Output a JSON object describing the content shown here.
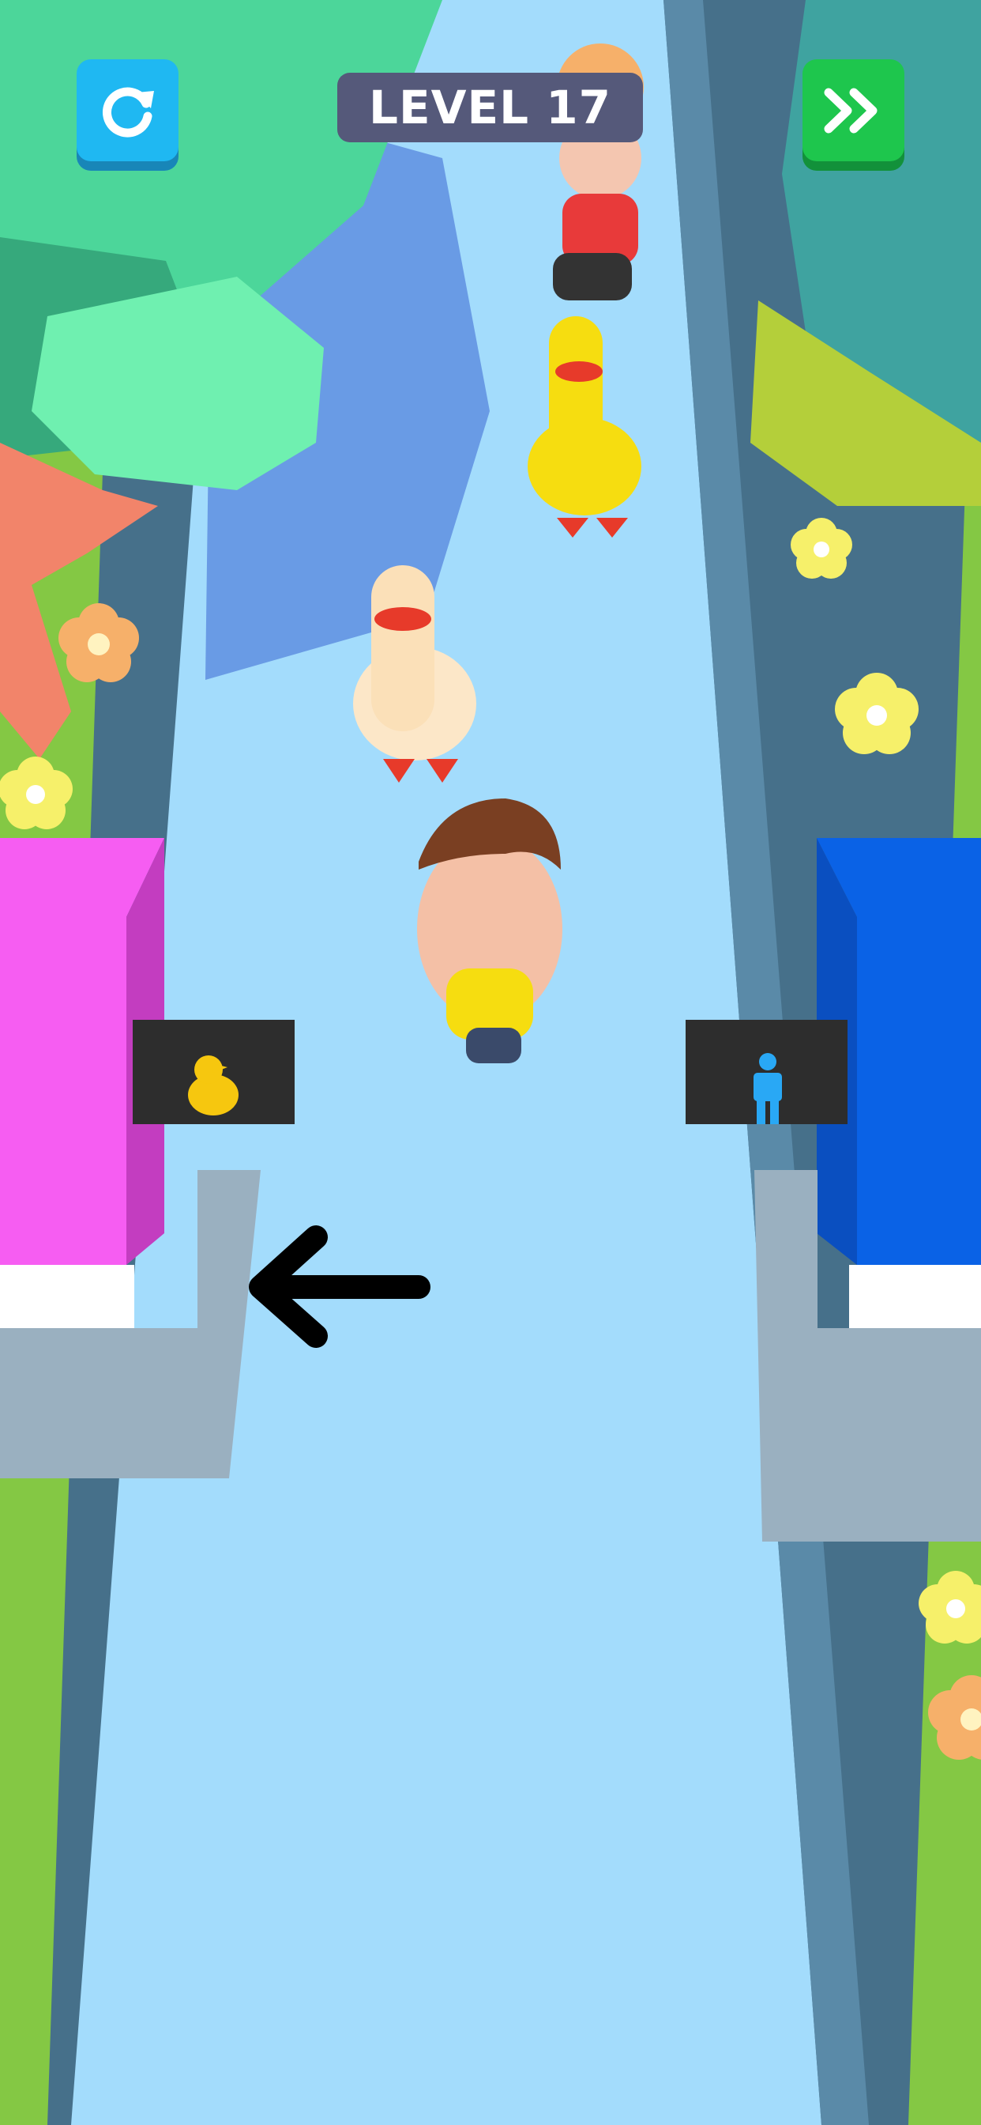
{
  "hud": {
    "level_text": "LEVEL 17",
    "restart_icon": "restart-icon",
    "skip_icon": "fast-forward-icon"
  },
  "gates": {
    "left": {
      "icon": "duck-icon",
      "color": "#f65df2"
    },
    "right": {
      "icon": "person-icon",
      "color": "#0a62e6"
    }
  },
  "hint": {
    "icon": "arrow-left-icon"
  },
  "colors": {
    "path": "#a3dcfc",
    "grass": "#8fd14f",
    "restart_button": "#1fb8f2",
    "skip_button": "#1ec64d",
    "level_pill": "#55597a"
  }
}
